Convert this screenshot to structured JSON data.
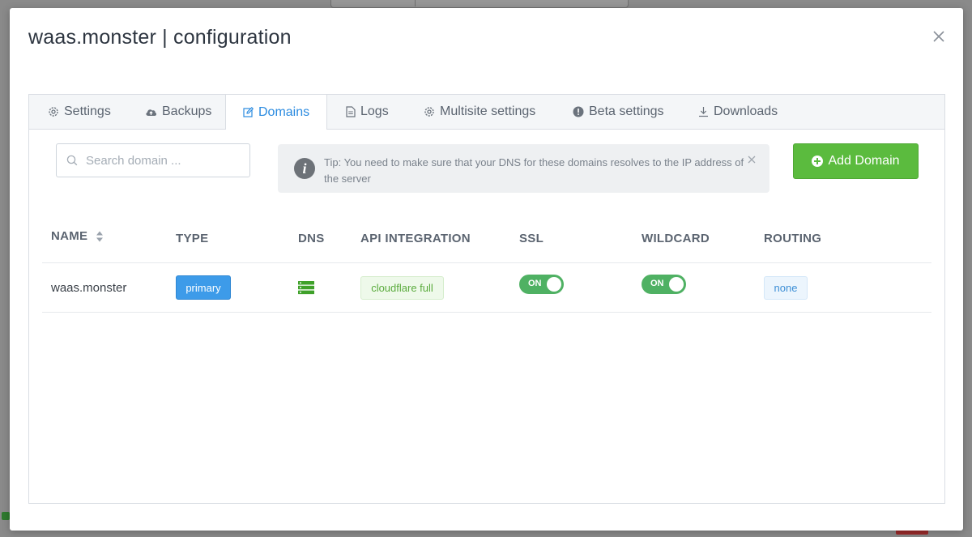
{
  "modal": {
    "title": "waas.monster | configuration"
  },
  "tabs": [
    {
      "label": "Settings",
      "icon": "gear-icon"
    },
    {
      "label": "Backups",
      "icon": "cloud-upload-icon"
    },
    {
      "label": "Domains",
      "icon": "edit-icon",
      "active": true
    },
    {
      "label": "Logs",
      "icon": "file-icon"
    },
    {
      "label": "Multisite settings",
      "icon": "gear-icon"
    },
    {
      "label": "Beta settings",
      "icon": "exclamation-circle-icon"
    },
    {
      "label": "Downloads",
      "icon": "download-icon"
    }
  ],
  "search": {
    "placeholder": "Search domain ..."
  },
  "tip": {
    "text": "Tip: You need to make sure that your DNS for these domains resolves to the IP address of the server"
  },
  "add_button": {
    "label": "Add Domain"
  },
  "table": {
    "headers": [
      "NAME",
      "TYPE",
      "DNS",
      "API INTEGRATION",
      "SSL",
      "WILDCARD",
      "ROUTING"
    ],
    "rows": [
      {
        "name": "waas.monster",
        "type": "primary",
        "dns_icon": "server-icon",
        "api_integration": "cloudflare full",
        "ssl": "ON",
        "wildcard": "ON",
        "routing": "none"
      }
    ]
  },
  "colors": {
    "accent": "#2b8be0",
    "success": "#5bbb3e",
    "toggle_on": "#4fb163",
    "primary_badge": "#3d9be9"
  }
}
